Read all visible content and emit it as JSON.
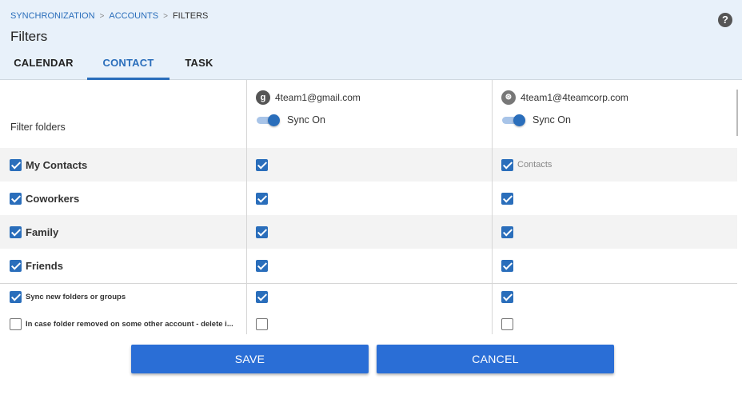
{
  "breadcrumb": {
    "item1": "SYNCHRONIZATION",
    "item2": "ACCOUNTS",
    "current": "FILTERS",
    "separator": ">"
  },
  "page_title": "Filters",
  "help_icon_glyph": "?",
  "tabs": [
    {
      "label": "CALENDAR",
      "active": false
    },
    {
      "label": "CONTACT",
      "active": true
    },
    {
      "label": "TASK",
      "active": false
    }
  ],
  "filter_folders_label": "Filter folders",
  "accounts": [
    {
      "icon": "google-icon",
      "icon_glyph": "g",
      "email": "4team1@gmail.com",
      "sync_label": "Sync On",
      "sync_on": true
    },
    {
      "icon": "4team-corp-icon",
      "icon_glyph": "⊛",
      "email": "4team1@4teamcorp.com",
      "sync_label": "Sync On",
      "sync_on": true
    }
  ],
  "folders": [
    {
      "label": "My Contacts",
      "checked": true,
      "acct1": true,
      "acct2": true,
      "acct2_sublabel": "Contacts"
    },
    {
      "label": "Coworkers",
      "checked": true,
      "acct1": true,
      "acct2": true
    },
    {
      "label": "Family",
      "checked": true,
      "acct1": true,
      "acct2": true
    },
    {
      "label": "Friends",
      "checked": true,
      "acct1": true,
      "acct2": true
    }
  ],
  "options": [
    {
      "label": "Sync new folders or groups",
      "checked": true,
      "acct1": true,
      "acct2": true
    },
    {
      "label": "In case folder removed on some other account - delete i...",
      "checked": false,
      "acct1": false,
      "acct2": false
    }
  ],
  "buttons": {
    "save": "SAVE",
    "cancel": "CANCEL"
  },
  "colors": {
    "accent": "#2a6ebb",
    "header_bg": "#e8f1fa",
    "button": "#2a6ed6"
  }
}
